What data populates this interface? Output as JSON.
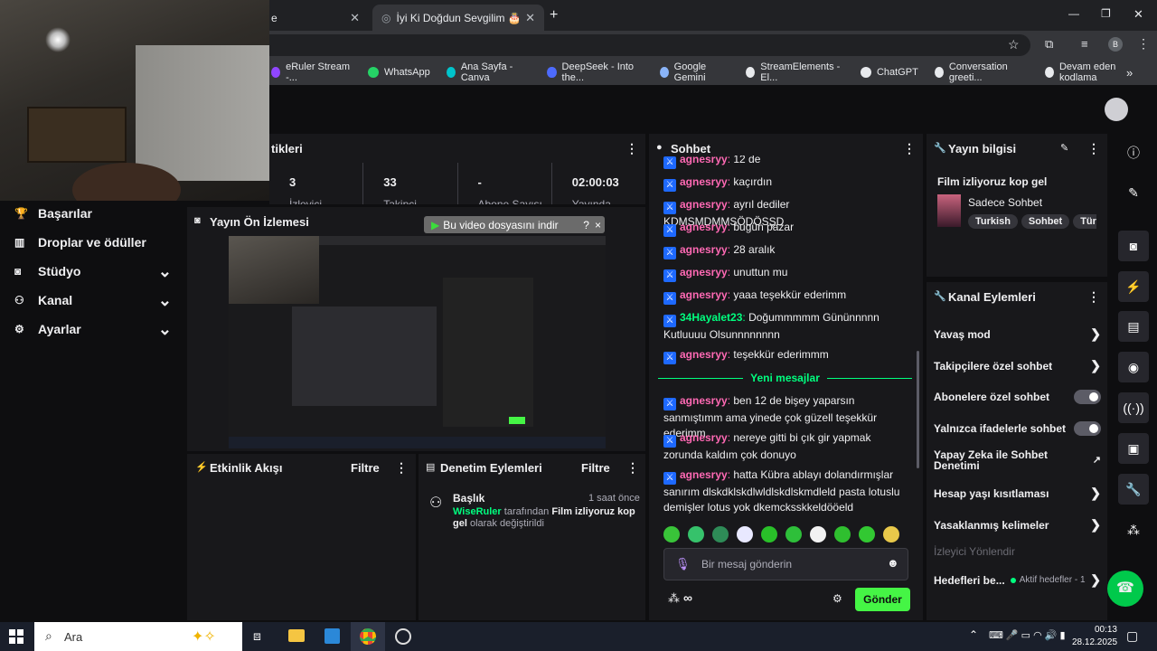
{
  "browser": {
    "tab1_title": "e",
    "tab2_title": "İyi Ki Doğdun Sevgilim 🎂",
    "profile_letter": "B",
    "bookmarks": [
      {
        "label": "eRuler Stream -...",
        "color": "#9146ff"
      },
      {
        "label": "WhatsApp",
        "color": "#25d366"
      },
      {
        "label": "Ana Sayfa - Canva",
        "color": "#00c4cc"
      },
      {
        "label": "DeepSeek - Into the...",
        "color": "#4d6bfe"
      },
      {
        "label": "Google Gemini",
        "color": "#8ab4f8"
      },
      {
        "label": "StreamElements - El...",
        "color": "#e8eaed"
      },
      {
        "label": "ChatGPT",
        "color": "#e8eaed"
      },
      {
        "label": "Conversation greeti...",
        "color": "#e8eaed"
      },
      {
        "label": "Devam eden kodlama",
        "color": "#e8eaed"
      }
    ]
  },
  "stats": {
    "title": "tikleri",
    "items": [
      {
        "value": "3",
        "label": "İzleyici"
      },
      {
        "value": "33",
        "label": "Takipçi"
      },
      {
        "value": "-",
        "label": "Abone Sayısı"
      },
      {
        "value": "02:00:03",
        "label": "Yayında"
      }
    ]
  },
  "nav": {
    "items": [
      {
        "label": "Başarılar",
        "icon": "trophy-icon",
        "chevron": false
      },
      {
        "label": "Droplar ve ödüller",
        "icon": "gift-icon",
        "chevron": false
      },
      {
        "label": "Stüdyo",
        "icon": "studio-icon",
        "chevron": true
      },
      {
        "label": "Kanal",
        "icon": "user-group-icon",
        "chevron": true
      },
      {
        "label": "Ayarlar",
        "icon": "gear-icon",
        "chevron": true
      }
    ]
  },
  "preview": {
    "title": "Yayın Ön İzlemesi",
    "download_prompt": "Bu video dosyasını indir",
    "help": "?",
    "close": "×"
  },
  "activity": {
    "title": "Etkinlik Akışı",
    "filter": "Filtre"
  },
  "moderation": {
    "title": "Denetim Eylemleri",
    "filter": "Filtre",
    "entry": {
      "heading": "Başlık",
      "time": "1 saat önce",
      "user": "WiseRuler",
      "by": "tarafından",
      "title_value": "Film izliyoruz kop gel",
      "suffix": "olarak değiştirildi"
    }
  },
  "chat": {
    "title": "Sohbet",
    "messages_old": [
      {
        "user": "agnesryy",
        "text": "12 de",
        "color": "pink"
      },
      {
        "user": "agnesryy",
        "text": "kaçırdın",
        "color": "pink"
      },
      {
        "user": "agnesryy",
        "text": "ayrıl dediler KDMSMDMMSÖDÖSŞD",
        "color": "pink"
      },
      {
        "user": "agnesryy",
        "text": "bugün pazar",
        "color": "pink"
      },
      {
        "user": "agnesryy",
        "text": "28 aralık",
        "color": "pink"
      },
      {
        "user": "agnesryy",
        "text": "unuttun mu",
        "color": "pink"
      },
      {
        "user": "agnesryy",
        "text": "yaaa teşekkür ederimm",
        "color": "pink"
      },
      {
        "user": "34Hayalet23",
        "text": "Doğummmmm Gününnnnn Kutluuuu Olsunnnnnnnn",
        "color": "green"
      },
      {
        "user": "agnesryy",
        "text": "teşekkür ederimmm",
        "color": "pink"
      }
    ],
    "divider": "Yeni mesajlar",
    "messages_new": [
      {
        "user": "agnesryy",
        "text": "ben 12 de bişey yaparsın sanmıştımm ama yinede çok güzell teşekkür ederimm"
      },
      {
        "user": "agnesryy",
        "text": "nereye gitti bi çık gir yapmak zorunda kaldım çok donuyo"
      },
      {
        "user": "agnesryy",
        "text": "hatta Kübra ablayı dolandırmışlar sanırım dlskdklskdlwldlskdlskmdleld pasta lotuslu demişler lotus yok dkemcksskkeldööeld"
      }
    ],
    "input_placeholder": "Bir mesaj gönderin",
    "send_label": "Gönder",
    "points": "∞"
  },
  "stream_info": {
    "title": "Yayın bilgisi",
    "stream_title": "Film izliyoruz kop gel",
    "category": "Sadece Sohbet",
    "tags": [
      "Turkish",
      "Sohbet",
      "Türkçe"
    ]
  },
  "channel_actions": {
    "title": "Kanal Eylemleri",
    "slow_mode": "Yavaş mod",
    "followers_only": "Takipçilere özel sohbet",
    "subs_only": "Abonelere özel sohbet",
    "emotes_only": "Yalnızca ifadelerle sohbet",
    "ai_mod": "Yapay Zeka ile Sohbet Denetimi",
    "age_restriction": "Hesap yaşı kısıtlaması",
    "banned_words": "Yasaklanmış kelimeler",
    "viewer_guide": "İzleyici Yönlendir",
    "goals": "Hedefleri be...",
    "goals_status": "Aktif hedefler - 1"
  },
  "taskbar": {
    "search": "Ara",
    "time": "00:13",
    "date": "28.12.2025"
  },
  "colors": {
    "accent_green": "#00ff7f",
    "send_green": "#45f545",
    "username_pink": "#ff69b4",
    "badge_blue": "#1e69ff"
  }
}
